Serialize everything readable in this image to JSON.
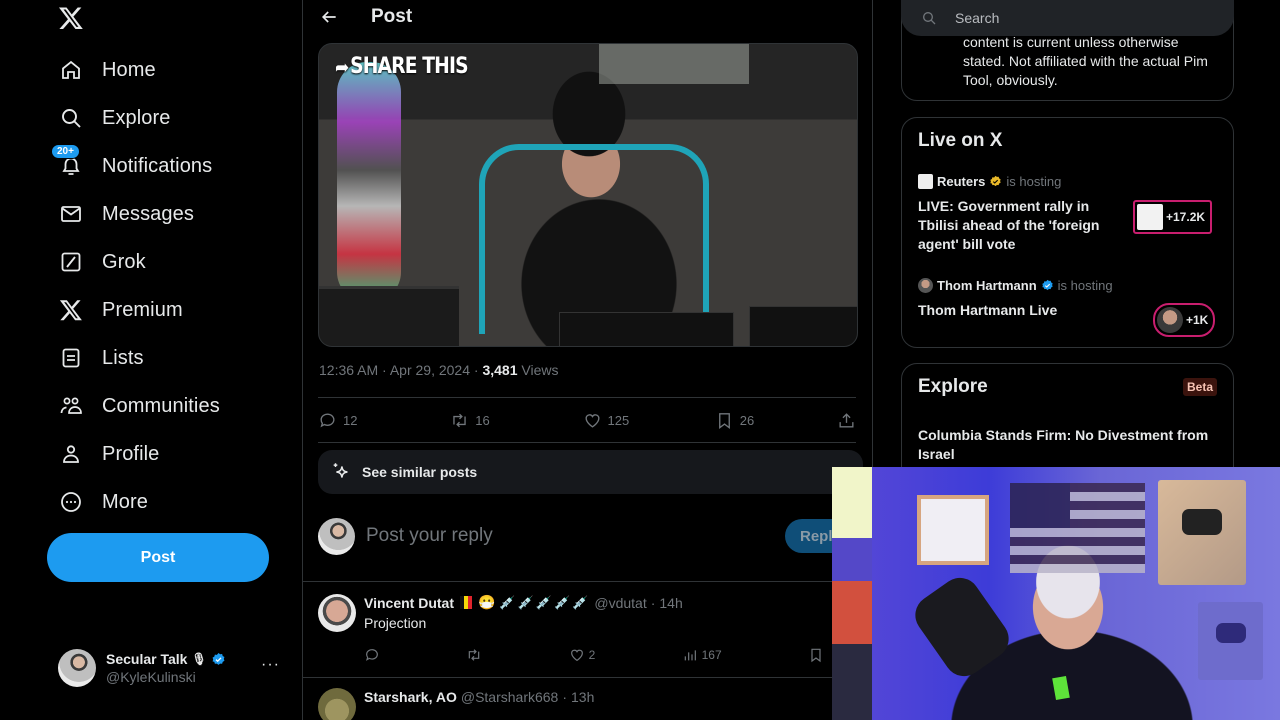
{
  "app": {
    "logo": "x-logo"
  },
  "sidebar": {
    "items": [
      {
        "label": "Home",
        "icon": "home-icon"
      },
      {
        "label": "Explore",
        "icon": "search-icon"
      },
      {
        "label": "Notifications",
        "icon": "bell-icon",
        "badge": "20+"
      },
      {
        "label": "Messages",
        "icon": "mail-icon"
      },
      {
        "label": "Grok",
        "icon": "grok-icon"
      },
      {
        "label": "Premium",
        "icon": "x-icon"
      },
      {
        "label": "Lists",
        "icon": "list-icon"
      },
      {
        "label": "Communities",
        "icon": "communities-icon"
      },
      {
        "label": "Profile",
        "icon": "profile-icon"
      },
      {
        "label": "More",
        "icon": "more-circle-icon"
      }
    ],
    "post_button": "Post",
    "account": {
      "name": "Secular Talk",
      "name_emoji": "🎙",
      "handle": "@KyleKulinski",
      "more": "···"
    }
  },
  "main": {
    "header": {
      "title": "Post"
    },
    "media": {
      "overlay_text": "SHARE THIS",
      "overlay_arrow": "➦"
    },
    "meta": {
      "time": "12:36 AM",
      "date": "Apr 29, 2024",
      "views_count": "3,481",
      "views_label": "Views",
      "sep": " · "
    },
    "actions": {
      "replies": "12",
      "reposts": "16",
      "likes": "125",
      "bookmarks": "26"
    },
    "similar": {
      "label": "See similar posts"
    },
    "composer": {
      "placeholder": "Post your reply",
      "button": "Reply"
    },
    "replies": [
      {
        "name": "Vincent Dutat",
        "emoji": "😷",
        "syringes": "💉💉💉💉💉",
        "handle": "@vdutat",
        "time": "14h",
        "text": "Projection",
        "likes": "2",
        "views": "167"
      },
      {
        "name": "Starshark, AO",
        "handle": "@Starshark668",
        "time": "13h"
      }
    ]
  },
  "right": {
    "search": {
      "placeholder": "Search"
    },
    "about": {
      "text": "content is current unless otherwise stated. Not affiliated with the actual Pim Tool, obviously."
    },
    "live": {
      "title": "Live on X",
      "items": [
        {
          "host": "Reuters",
          "hosting": "is hosting",
          "title": "LIVE: Government rally in Tbilisi ahead of the 'foreign agent' bill vote",
          "listeners": "+17.2K",
          "verified": "gold"
        },
        {
          "host": "Thom Hartmann",
          "hosting": "is hosting",
          "title": "Thom Hartmann Live",
          "listeners": "+1K",
          "verified": "blue"
        }
      ]
    },
    "explore": {
      "title": "Explore",
      "badge": "Beta",
      "items": [
        {
          "title": "Columbia Stands Firm: No Divestment from Israel"
        }
      ]
    }
  },
  "colors": {
    "accent": "#1d9bf0",
    "live_ring": "#c91e6f",
    "beta_bg": "#3b130d",
    "beta_text": "#f7c3b4",
    "verified_gold": "#e8b829"
  }
}
